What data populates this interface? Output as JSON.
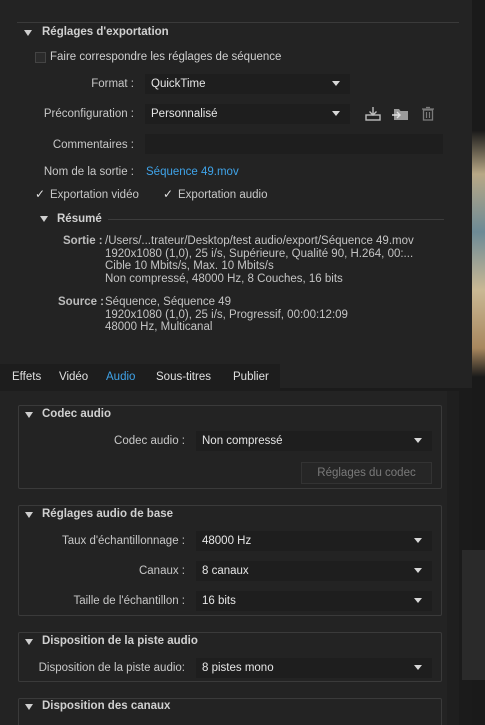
{
  "export_settings": {
    "title": "Réglages d'exportation",
    "match_sequence_label": "Faire correspondre les réglages de séquence",
    "format_label": "Format :",
    "format_value": "QuickTime",
    "preset_label": "Préconfiguration :",
    "preset_value": "Personnalisé",
    "comments_label": "Commentaires :",
    "comments_value": "",
    "output_name_label": "Nom de la sortie :",
    "output_name_value": "Séquence 49.mov",
    "export_video_label": "Exportation vidéo",
    "export_audio_label": "Exportation audio",
    "summary": {
      "title": "Résumé",
      "output_label": "Sortie :",
      "output_lines": [
        "/Users/...trateur/Desktop/test audio/export/Séquence 49.mov",
        "1920x1080 (1,0), 25 i/s, Supérieure, Qualité  90, H.264, 00:...",
        "Cible 10 Mbits/s, Max. 10 Mbits/s",
        "Non compressé, 48000  Hz, 8 Couches, 16 bits"
      ],
      "source_label": "Source :",
      "source_lines": [
        "Séquence, Séquence 49",
        "1920x1080 (1,0), 25  i/s, Progressif, 00:00:12:09",
        "48000 Hz, Multicanal"
      ]
    }
  },
  "tabs": [
    {
      "label": "Effets",
      "active": false
    },
    {
      "label": "Vidéo",
      "active": false
    },
    {
      "label": "Audio",
      "active": true
    },
    {
      "label": "Sous-titres",
      "active": false
    },
    {
      "label": "Publier",
      "active": false
    }
  ],
  "codec_section": {
    "title": "Codec audio",
    "codec_label": "Codec audio :",
    "codec_value": "Non compressé",
    "codec_settings_button": "Réglages du codec"
  },
  "basic_audio": {
    "title": "Réglages audio de base",
    "sample_rate_label": "Taux d'échantillonnage :",
    "sample_rate_value": "48000 Hz",
    "channels_label": "Canaux :",
    "channels_value": "8 canaux",
    "sample_size_label": "Taille de l'échantillon :",
    "sample_size_value": "16 bits"
  },
  "track_layout": {
    "title": "Disposition de la piste audio",
    "layout_label": "Disposition de la piste audio:",
    "layout_value": "8 pistes mono"
  },
  "channel_layout": {
    "title": "Disposition des canaux"
  },
  "colors": {
    "accent": "#3fa3e8",
    "panel_bg": "#232323"
  }
}
